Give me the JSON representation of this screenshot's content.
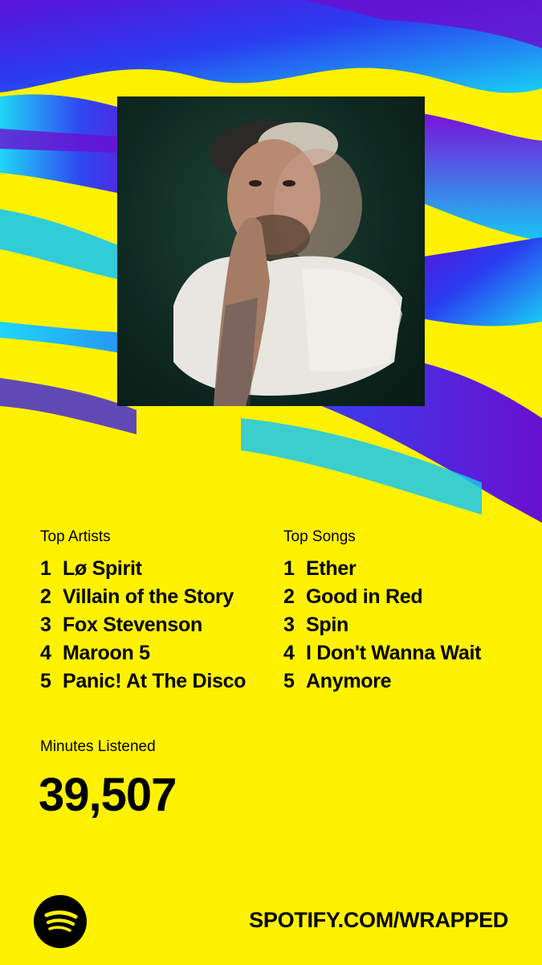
{
  "top_artists": {
    "title": "Top Artists",
    "items": [
      {
        "rank": "1",
        "name": "Lø Spirit"
      },
      {
        "rank": "2",
        "name": "Villain of the Story"
      },
      {
        "rank": "3",
        "name": "Fox Stevenson"
      },
      {
        "rank": "4",
        "name": "Maroon 5"
      },
      {
        "rank": "5",
        "name": "Panic! At The Disco"
      }
    ]
  },
  "top_songs": {
    "title": "Top Songs",
    "items": [
      {
        "rank": "1",
        "name": "Ether"
      },
      {
        "rank": "2",
        "name": "Good in Red"
      },
      {
        "rank": "3",
        "name": "Spin"
      },
      {
        "rank": "4",
        "name": "I Don't Wanna Wait"
      },
      {
        "rank": "5",
        "name": "Anymore"
      }
    ]
  },
  "minutes": {
    "label": "Minutes Listened",
    "value": "39,507"
  },
  "footer": {
    "url": "SPOTIFY.COM/WRAPPED",
    "logo_icon": "spotify-logo-icon"
  },
  "colors": {
    "background": "#fff200",
    "accent_blue": "#3a1ee0",
    "accent_cyan": "#19c8f0",
    "accent_purple": "#6a0fd0"
  }
}
